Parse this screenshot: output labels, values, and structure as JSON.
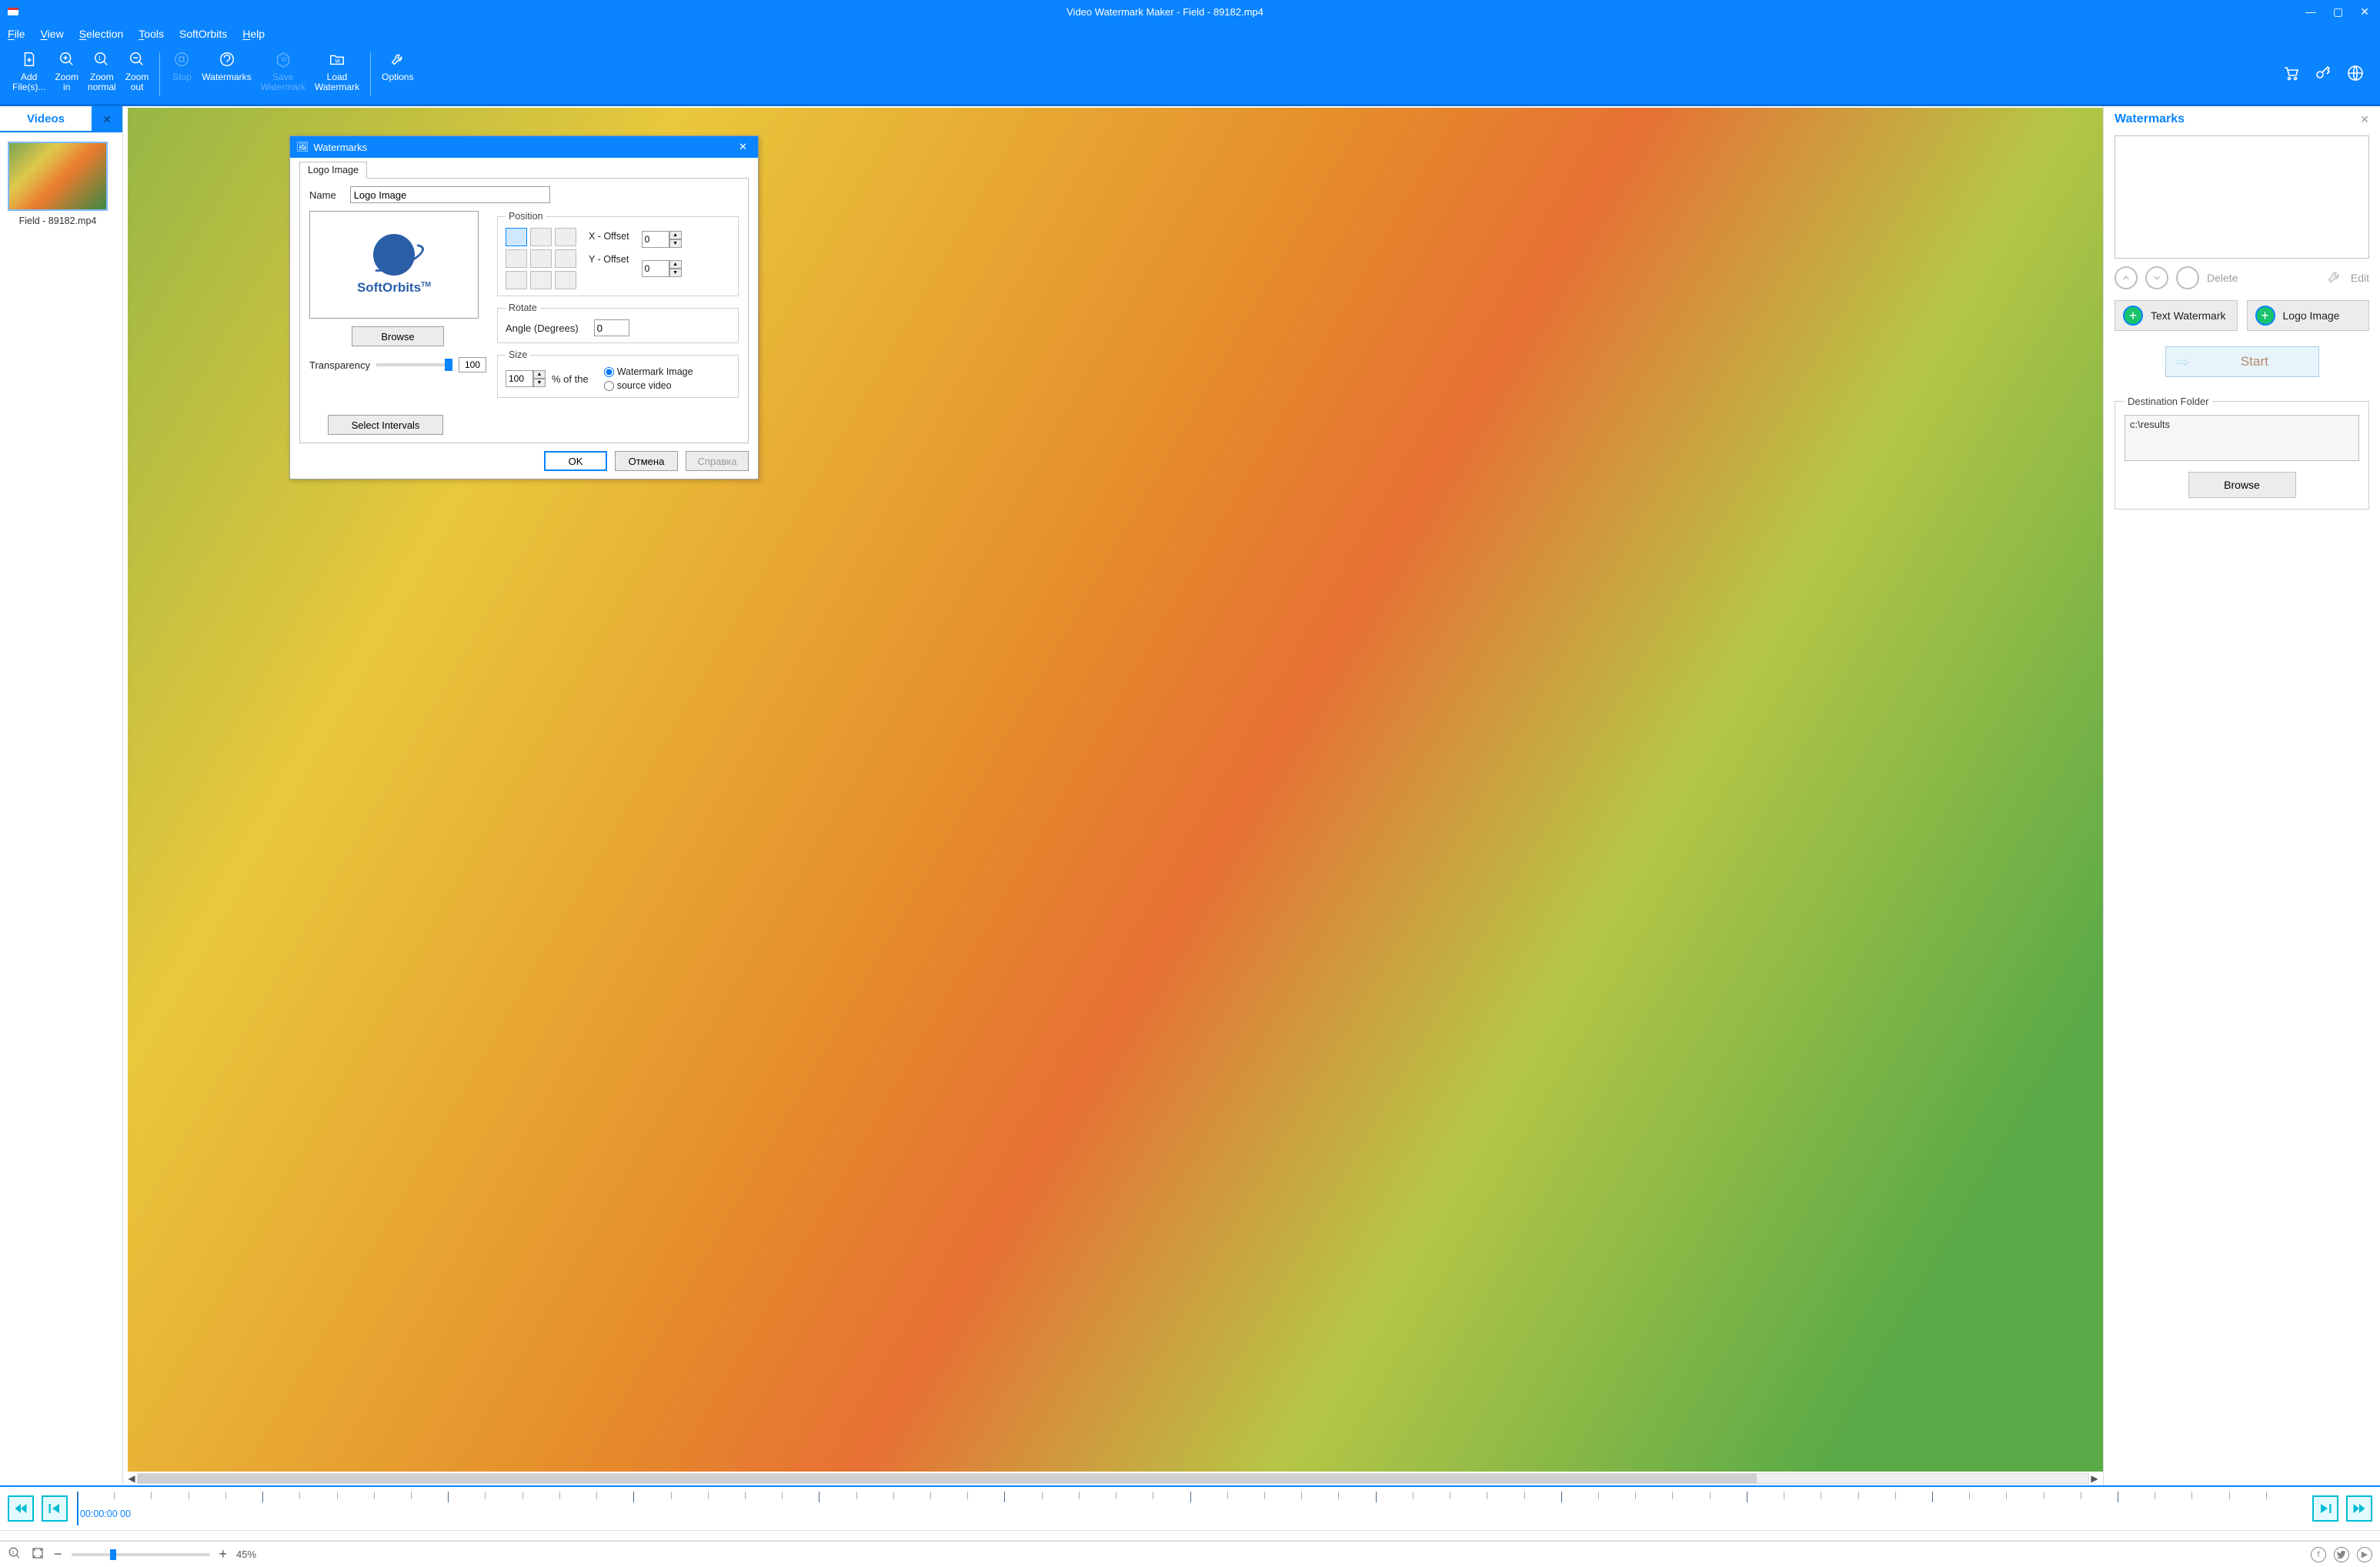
{
  "app": {
    "title": "Video Watermark Maker - Field - 89182.mp4"
  },
  "menu": {
    "file": "File",
    "view": "View",
    "selection": "Selection",
    "tools": "Tools",
    "softorbits": "SoftOrbits",
    "help": "Help"
  },
  "ribbon": {
    "addfiles": "Add\nFile(s)...",
    "zoomin": "Zoom\nin",
    "zoomnormal": "Zoom\nnormal",
    "zoomout": "Zoom\nout",
    "stop": "Stop",
    "watermarks": "Watermarks",
    "savewm": "Save\nWatermark",
    "loadwm": "Load\nWatermark",
    "options": "Options"
  },
  "left": {
    "tab": "Videos",
    "thumb_caption": "Field - 89182.mp4"
  },
  "right": {
    "title": "Watermarks",
    "delete": "Delete",
    "edit": "Edit",
    "textwm": "Text Watermark",
    "logowm": "Logo Image",
    "start": "Start",
    "dest_legend": "Destination Folder",
    "dest_path": "c:\\results",
    "browse": "Browse"
  },
  "timeline": {
    "timecode": "00:00:00 00"
  },
  "status": {
    "zoom_pct": "45%"
  },
  "dialog": {
    "title": "Watermarks",
    "tab": "Logo Image",
    "name_label": "Name",
    "name_value": "Logo Image",
    "logo_text": "SoftOrbits",
    "logo_tm": "TM",
    "browse": "Browse",
    "transparency_label": "Transparency",
    "transparency_value": "100",
    "pos_legend": "Position",
    "xoff_label": "X - Offset",
    "xoff": "0",
    "yoff_label": "Y - Offset",
    "yoff": "0",
    "rot_legend": "Rotate",
    "angle_label": "Angle (Degrees)",
    "angle": "0",
    "size_legend": "Size",
    "size_pct": "100",
    "pct_of": "% of the",
    "radio_wm": "Watermark Image",
    "radio_src": "source video",
    "select_intervals": "Select Intervals",
    "ok": "OK",
    "cancel": "Отмена",
    "help": "Справка"
  }
}
